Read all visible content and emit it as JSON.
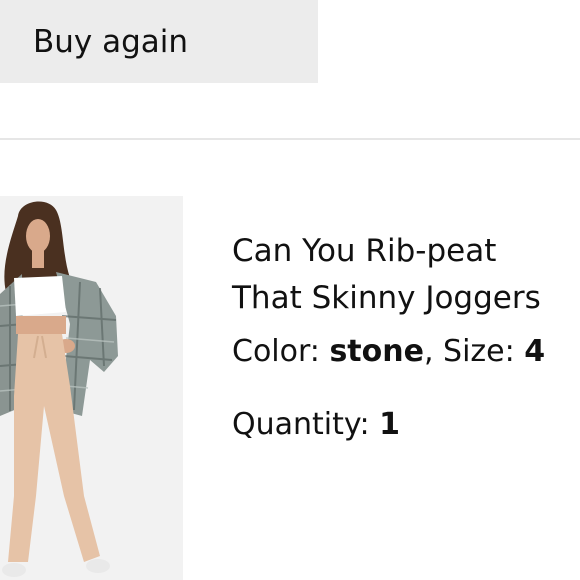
{
  "actions": {
    "buy_again_label": "Buy again"
  },
  "product": {
    "title_line1": "Can You Rib-peat",
    "title_line2": "That Skinny Joggers",
    "color_label": "Color:",
    "color_value": "stone",
    "size_label": "Size:",
    "size_value": "4",
    "quantity_label": "Quantity:",
    "quantity_value": "1"
  },
  "colors": {
    "button_bg": "#ececec",
    "divider": "#e6e6e6",
    "image_bg": "#f2f2f2",
    "joggers": "#e6c3a7"
  }
}
